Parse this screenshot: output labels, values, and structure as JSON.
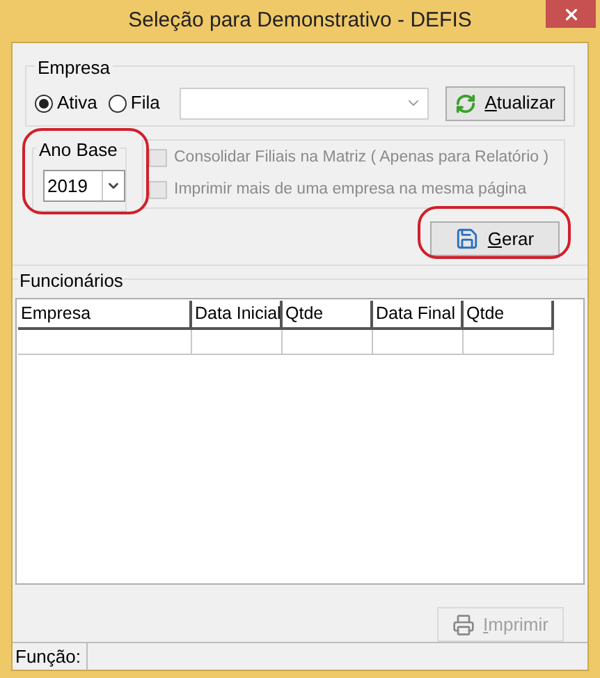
{
  "window": {
    "title": "Seleção para Demonstrativo - DEFIS"
  },
  "empresa": {
    "label": "Empresa",
    "options": [
      {
        "label": "Ativa",
        "selected": true
      },
      {
        "label": "Fila",
        "selected": false
      }
    ],
    "refresh_button": "Atualizar"
  },
  "ano_base": {
    "label": "Ano Base",
    "value": "2019"
  },
  "options": [
    {
      "label": "Consolidar Filiais na Matriz ( Apenas para Relatório )",
      "checked": false,
      "disabled": true
    },
    {
      "label": "Imprimir mais de uma empresa na mesma página",
      "checked": false,
      "disabled": true
    }
  ],
  "generate_button": {
    "label": "Gerar",
    "disabled": false
  },
  "funcionarios": {
    "label": "Funcionários",
    "columns": [
      "Empresa",
      "Data Inicial",
      "Qtde",
      "Data Final",
      "Qtde"
    ]
  },
  "print_button": {
    "label": "Imprimir",
    "disabled": true
  },
  "status_bar": {
    "label": "Função:"
  }
}
